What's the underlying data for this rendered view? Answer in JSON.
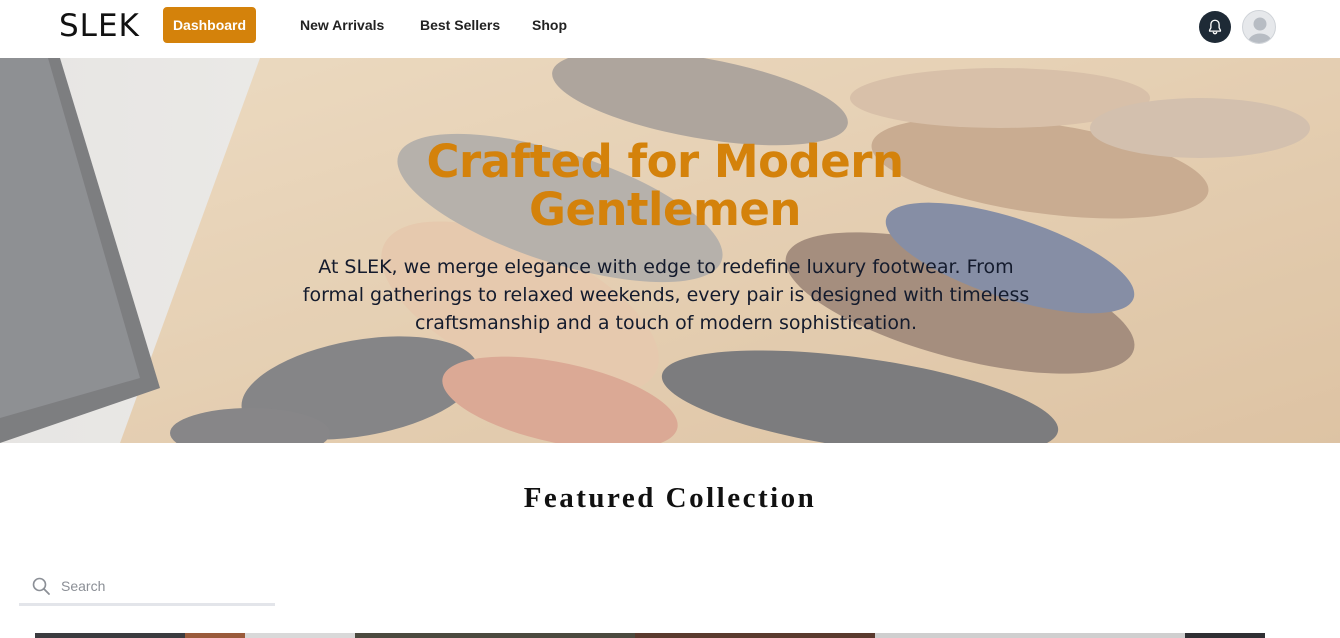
{
  "brand": "SLEK",
  "nav": {
    "active": "Dashboard",
    "links": [
      "New Arrivals",
      "Best Sellers",
      "Shop"
    ]
  },
  "icons": {
    "notifications": "bell-icon",
    "profile": "user-avatar-icon",
    "search": "search-icon"
  },
  "hero": {
    "title": "Crafted for Modern Gentlemen",
    "description": "At SLEK, we merge elegance with edge to redefine luxury footwear. From formal gatherings to relaxed weekends, every pair is designed with timeless craftsmanship and a touch of modern sophistication."
  },
  "featured": {
    "title": "Featured Collection",
    "search_placeholder": "Search"
  },
  "colors": {
    "accent": "#d4820b",
    "bell_bg": "#1e2a36",
    "text_dark": "#141b2d"
  }
}
